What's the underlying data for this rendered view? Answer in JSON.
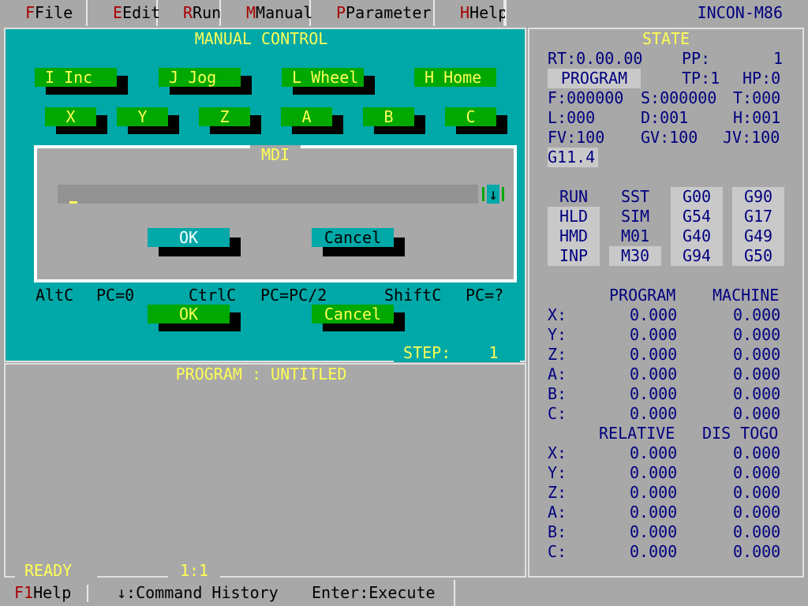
{
  "menu": {
    "items": [
      {
        "hotkey": "F",
        "label": "File"
      },
      {
        "hotkey": "E",
        "label": "Edit"
      },
      {
        "hotkey": "R",
        "label": "Run"
      },
      {
        "hotkey": "M",
        "label": "Manual"
      },
      {
        "hotkey": "P",
        "label": "Parameter"
      },
      {
        "hotkey": "H",
        "label": "Help"
      }
    ],
    "app_title": "INCON-M86"
  },
  "manual": {
    "title": "MANUAL CONTROL",
    "modes": [
      {
        "hotkey": "I",
        "label": "Inc"
      },
      {
        "hotkey": "J",
        "label": "Jog"
      },
      {
        "hotkey": "L",
        "label": "Wheel"
      },
      {
        "hotkey": "H",
        "label": "Home"
      }
    ],
    "axes": [
      "X",
      "Y",
      "Z",
      "A",
      "B",
      "C"
    ],
    "mdi": {
      "title": "MDI",
      "input_value": "",
      "scroll_glyph": "↓",
      "ok_label": "OK",
      "cancel_label": "Cancel"
    },
    "hints": [
      {
        "key": "AltC",
        "action": "PC=0"
      },
      {
        "key": "CtrlC",
        "action": "PC=PC/2"
      },
      {
        "key": "ShiftC",
        "action": "PC=?"
      }
    ],
    "ok_label": "OK",
    "cancel_label": "Cancel",
    "step_label": "STEP:",
    "step_value": "1"
  },
  "state": {
    "title": "STATE",
    "rt_label": "RT:",
    "rt_value": "0.00.00",
    "pp_label": "PP:",
    "pp_value": "1",
    "mode": "PROGRAM",
    "tp": "TP:1",
    "hp": "HP:0",
    "f": "F:000000",
    "s": "S:000000",
    "t": "T:000",
    "l": "L:000",
    "d": "D:001",
    "h": "H:001",
    "fv": "FV:100",
    "gv": "GV:100",
    "jv": "JV:100",
    "gcode": "G11.4",
    "status_grid": [
      [
        "RUN",
        "SST",
        "G00",
        "G90"
      ],
      [
        "HLD",
        "SIM",
        "G54",
        "G17"
      ],
      [
        "HMD",
        "M01",
        "G40",
        "G49"
      ],
      [
        "INP",
        "M30",
        "G94",
        "G50"
      ]
    ],
    "pos_header": [
      "PROGRAM",
      "MACHINE"
    ],
    "rel_header": [
      "RELATIVE",
      "DIS TOGO"
    ],
    "axes": [
      "X:",
      "Y:",
      "Z:",
      "A:",
      "B:",
      "C:"
    ],
    "program_pos": [
      "0.000",
      "0.000",
      "0.000",
      "0.000",
      "0.000",
      "0.000"
    ],
    "machine_pos": [
      "0.000",
      "0.000",
      "0.000",
      "0.000",
      "0.000",
      "0.000"
    ],
    "relative_pos": [
      "0.000",
      "0.000",
      "0.000",
      "0.000",
      "0.000",
      "0.000"
    ],
    "distogo_pos": [
      "0.000",
      "0.000",
      "0.000",
      "0.000",
      "0.000",
      "0.000"
    ]
  },
  "program": {
    "title": "PROGRAM : UNTITLED",
    "status": "READY",
    "cursor_pos": "1:1"
  },
  "statusbar": {
    "help_key": "F1",
    "help_label": "Help",
    "history_label": "↓:Command History",
    "execute_label": "Enter:Execute"
  },
  "colors": {
    "panel_cyan": "#00a8a8",
    "button_green": "#00a800",
    "label_yellow": "#ffff55",
    "value_navy": "#000080",
    "hotkey_red": "#a80000",
    "background_gray": "#a8a8a8"
  }
}
